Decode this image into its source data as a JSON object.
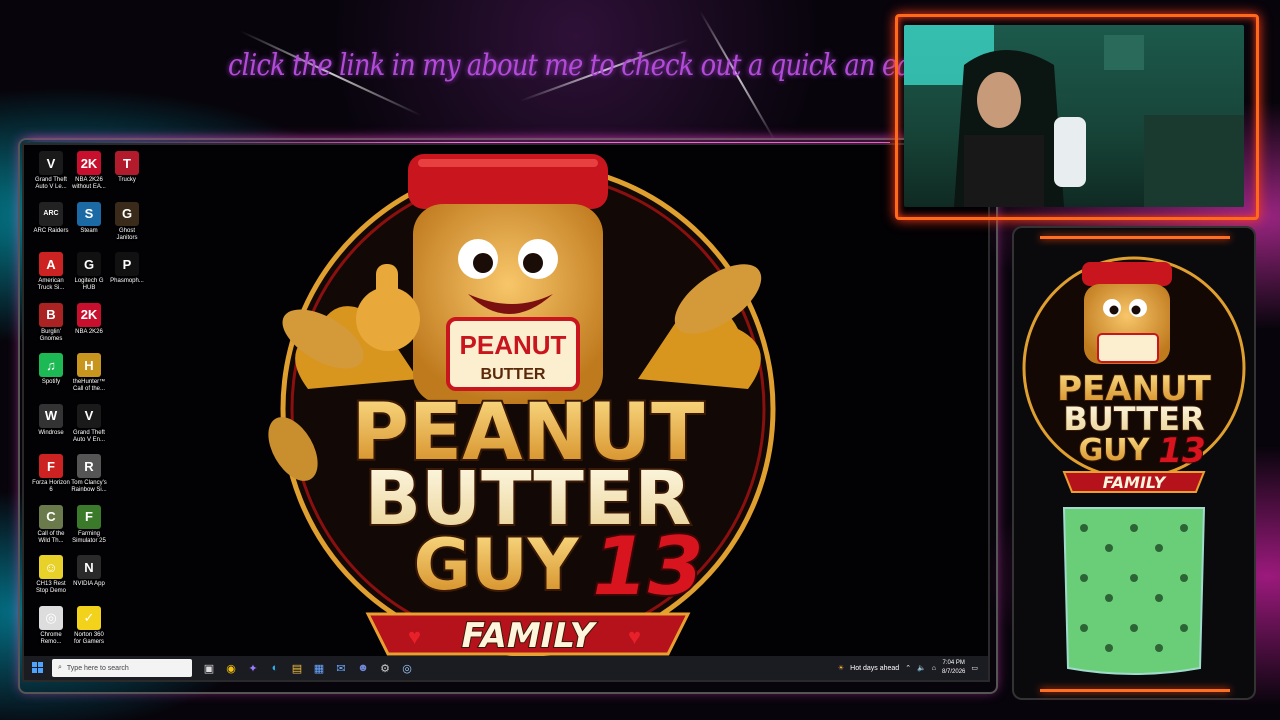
{
  "overlay": {
    "promo_text": "click the link in my about me to check out a quick an easy come up!"
  },
  "desktop_icons": [
    {
      "label": "Grand Theft Auto V Le...",
      "icon": "gta-v-icon",
      "color": "#1a1a1a",
      "glyph": "V"
    },
    {
      "label": "NBA 2K26 without EA...",
      "icon": "nba2k-icon",
      "color": "#c8102e",
      "glyph": "2K"
    },
    {
      "label": "Trucky",
      "icon": "trucky-icon",
      "color": "#b11b2b",
      "glyph": "T"
    },
    {
      "label": "ARC Raiders",
      "icon": "arc-raiders-icon",
      "color": "#222",
      "glyph": "ARC"
    },
    {
      "label": "Steam",
      "icon": "steam-icon",
      "color": "#1b6aa5",
      "glyph": "S"
    },
    {
      "label": "Ghost Janitors",
      "icon": "ghost-janitors-icon",
      "color": "#3a2a1a",
      "glyph": "G"
    },
    {
      "label": "American Truck Si...",
      "icon": "ats-icon",
      "color": "#c22",
      "glyph": "A"
    },
    {
      "label": "Logitech G HUB",
      "icon": "logitech-icon",
      "color": "#111",
      "glyph": "G"
    },
    {
      "label": "Phasmoph...",
      "icon": "phasmophobia-icon",
      "color": "#111",
      "glyph": "P"
    },
    {
      "label": "Burglin' Gnomes",
      "icon": "burglin-gnomes-icon",
      "color": "#a22",
      "glyph": "B"
    },
    {
      "label": "NBA 2K26",
      "icon": "nba2k-icon",
      "color": "#c8102e",
      "glyph": "2K"
    },
    {
      "label": "Spotify",
      "icon": "spotify-icon",
      "color": "#1db954",
      "glyph": "♫"
    },
    {
      "label": "theHunter™ Call of the...",
      "icon": "thehunter-icon",
      "color": "#c8961e",
      "glyph": "H"
    },
    {
      "label": "Windrose",
      "icon": "windrose-icon",
      "color": "#333",
      "glyph": "W"
    },
    {
      "label": "Grand Theft Auto V En...",
      "icon": "gta-v-icon",
      "color": "#1a1a1a",
      "glyph": "V"
    },
    {
      "label": "Forza Horizon 6",
      "icon": "forza-icon",
      "color": "#c22",
      "glyph": "F"
    },
    {
      "label": "Tom Clancy's Rainbow Si...",
      "icon": "rainbow-six-icon",
      "color": "#555",
      "glyph": "R"
    },
    {
      "label": "Call of the Wild Th...",
      "icon": "cotw-icon",
      "color": "#6a7a4a",
      "glyph": "C"
    },
    {
      "label": "Farming Simulator 25",
      "icon": "farming-sim-icon",
      "color": "#3b7a2a",
      "glyph": "F"
    },
    {
      "label": "CH13 Rest Stop Demo",
      "icon": "smiley-icon",
      "color": "#e8d22a",
      "glyph": "☺"
    },
    {
      "label": "NVIDIA App",
      "icon": "nvidia-icon",
      "color": "#2a2a2a",
      "glyph": "N"
    },
    {
      "label": "Chrome Remo...",
      "icon": "chrome-remote-icon",
      "color": "#ddd",
      "glyph": "◎"
    },
    {
      "label": "Norton 360 for Gamers",
      "icon": "norton-icon",
      "color": "#f2d21a",
      "glyph": "✓"
    }
  ],
  "logo": {
    "jar_label_1": "PEANUT",
    "jar_label_2": "BUTTER",
    "title_line_1": "PEANUT",
    "title_line_2": "BUTTER",
    "title_line_3": "GUY",
    "number": "13",
    "banner": "FAMILY",
    "colors": {
      "gold": "#f0a52a",
      "red": "#c8151e",
      "dark": "#1a0c06"
    }
  },
  "taskbar": {
    "search_placeholder": "Type here to search",
    "weather": "Hot days ahead",
    "time": "7:04 PM",
    "date": "8/7/2026",
    "apps": [
      "task-view-icon",
      "chrome-icon",
      "copilot-icon",
      "edge-icon",
      "file-explorer-icon",
      "store-icon",
      "mail-icon",
      "discord-icon",
      "settings-icon",
      "steam-icon"
    ]
  },
  "side_panel": {
    "title_line_1": "PEANUT",
    "title_line_2": "BUTTER",
    "title_line_3": "GUY",
    "number": "13",
    "banner": "FAMILY"
  }
}
